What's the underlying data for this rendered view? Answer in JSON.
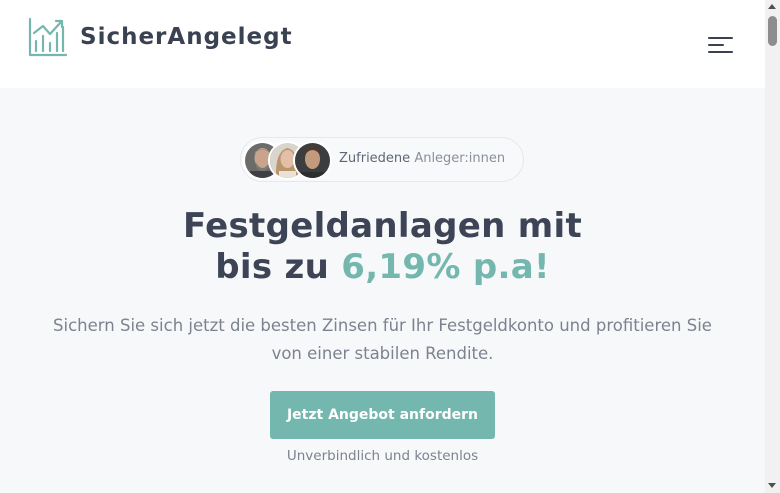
{
  "header": {
    "brand": "SicherAngelegt",
    "logo_icon": "chart-growth-icon",
    "menu_icon": "hamburger-menu-icon"
  },
  "hero": {
    "badge": {
      "strong": "Zufriedene",
      "rest": "Anleger:innen",
      "avatars": [
        "avatar-man-grey-hair",
        "avatar-woman-blonde",
        "avatar-man-dark-hair"
      ]
    },
    "headline_line1": "Festgeldanlagen mit",
    "headline_prefix": "bis zu",
    "headline_accent": "6,19% p.a!",
    "subtext": "Sichern Sie sich jetzt die besten Zinsen für Ihr Festgeldkonto und profitieren Sie von einer stabilen Rendite.",
    "cta_label": "Jetzt Angebot anfordern",
    "cta_note": "Unverbindlich und kostenlos"
  },
  "colors": {
    "accent": "#74b7ae",
    "heading": "#3c4456",
    "body_text": "#7c8390",
    "hero_background": "#f7f8fa"
  }
}
